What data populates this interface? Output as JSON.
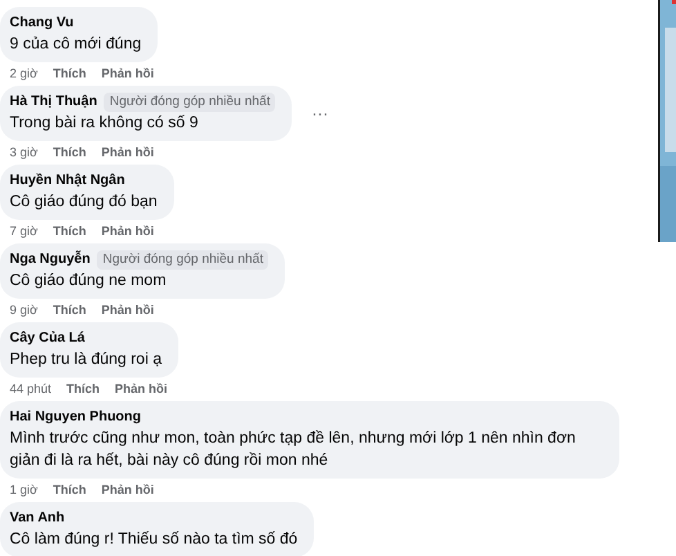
{
  "comments": [
    {
      "author": "Chang Vu",
      "text": "9 của cô mới đúng",
      "time": "2 giờ",
      "like": "Thích",
      "reply": "Phản hồi"
    },
    {
      "author": "Hà Thị Thuận",
      "badge": "Người đóng góp nhiều nhất",
      "text": "Trong bài ra không có số 9",
      "time": "3 giờ",
      "like": "Thích",
      "reply": "Phản hồi",
      "more": "···"
    },
    {
      "author": "Huyền Nhật Ngân",
      "text": "Cô giáo đúng đó bạn",
      "time": "7 giờ",
      "like": "Thích",
      "reply": "Phản hồi"
    },
    {
      "author": "Nga Nguyễn",
      "badge": "Người đóng góp nhiều nhất",
      "text": "Cô giáo đúng ne mom",
      "time": "9 giờ",
      "like": "Thích",
      "reply": "Phản hồi"
    },
    {
      "author": "Cây Của Lá",
      "text": "Phep tru là đúng roi ạ",
      "time": "44 phút",
      "like": "Thích",
      "reply": "Phản hồi"
    },
    {
      "author": "Hai Nguyen Phuong",
      "text": "Mình trước cũng như mon, toàn phức tạp đề lên, nhưng mới lớp 1 nên nhìn đơn giản đi là ra hết, bài này cô đúng rồi mon nhé",
      "time": "1 giờ",
      "like": "Thích",
      "reply": "Phản hồi"
    },
    {
      "author": "Van Anh",
      "text": "Cô làm đúng r! Thiếu số nào ta tìm số đó"
    }
  ]
}
